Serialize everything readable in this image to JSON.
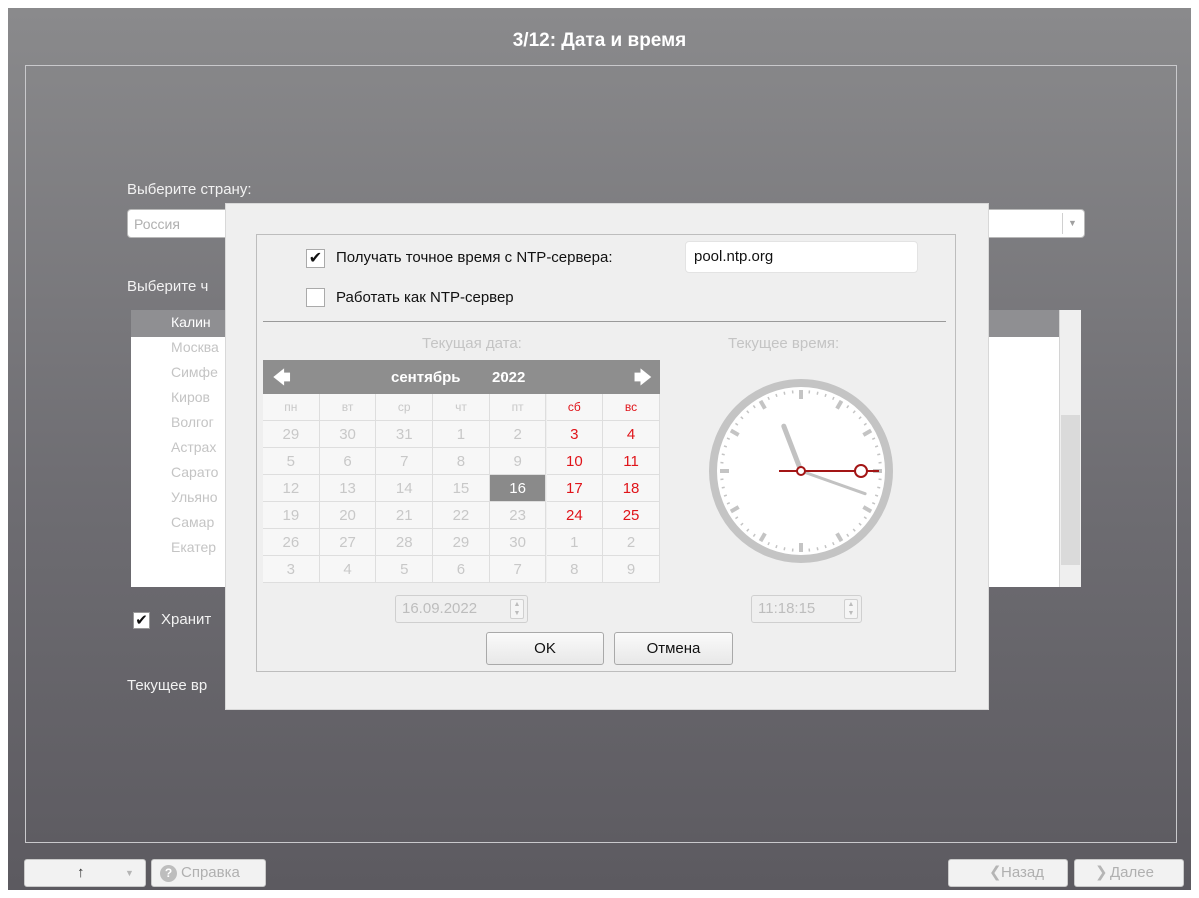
{
  "title": "3/12: Дата и время",
  "country": {
    "label": "Выберите страну:",
    "value": "Россия"
  },
  "zone": {
    "label": "Выберите ч",
    "items": [
      "Калин",
      "Москва",
      "Симфе",
      "Киров",
      "Волгог",
      "Астрах",
      "Сарато",
      "Ульяно",
      "Самар",
      "Екатер"
    ]
  },
  "keep_checkbox": {
    "mark": "✔",
    "label": "Хранит"
  },
  "current_time_label": "Текущее вр",
  "bottom": {
    "up_arrow": "↑",
    "dropdown": "▼",
    "help_icon": "?",
    "help": "Справка",
    "back_arrow": "❮",
    "back": "Назад",
    "next_arrow": "❯",
    "next": "Далее"
  },
  "dialog": {
    "ntp_check_mark": "✔",
    "ntp_label": "Получать точное время с NTP-сервера:",
    "ntp_server": "pool.ntp.org",
    "server_label": "Работать как NTP-сервер",
    "date_caption": "Текущая дата:",
    "time_caption": "Текущее время:",
    "calendar": {
      "prev_icon": "🡄",
      "next_icon": "🡆",
      "month": "сентябрь",
      "year": "2022",
      "weekdays": [
        "пн",
        "вт",
        "ср",
        "чт",
        "пт",
        "сб",
        "вс"
      ],
      "weeks": [
        [
          "29",
          "30",
          "31",
          "1",
          "2",
          "3",
          "4"
        ],
        [
          "5",
          "6",
          "7",
          "8",
          "9",
          "10",
          "11"
        ],
        [
          "12",
          "13",
          "14",
          "15",
          "16",
          "17",
          "18"
        ],
        [
          "19",
          "20",
          "21",
          "22",
          "23",
          "24",
          "25"
        ],
        [
          "26",
          "27",
          "28",
          "29",
          "30",
          "1",
          "2"
        ],
        [
          "3",
          "4",
          "5",
          "6",
          "7",
          "8",
          "9"
        ]
      ],
      "selected_day": "16",
      "weekend_color": "#e0141a",
      "selected_color": "#8a8a8a"
    },
    "date_value": "16.09.2022",
    "time_value": "11:18:15",
    "spin_up": "▲",
    "spin_down": "▼",
    "clock": {
      "hours": 11,
      "minutes": 18,
      "seconds": 15,
      "second_hand_color": "#a31515"
    },
    "ok": "OK",
    "cancel": "Отмена"
  }
}
